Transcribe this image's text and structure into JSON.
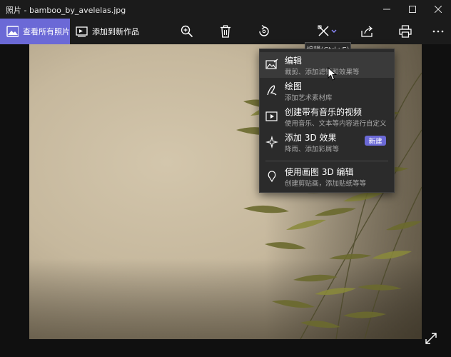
{
  "window": {
    "title": "照片 - bamboo_by_avelelas.jpg",
    "controls": [
      "minimize",
      "maximize",
      "close"
    ]
  },
  "toolbar": {
    "view_all_label": "查看所有照片",
    "add_to_creation_label": "添加到新作品",
    "icons": [
      "zoom-icon",
      "delete-icon",
      "rotate-icon",
      "edit-create-icon",
      "share-icon",
      "print-icon",
      "more-icon"
    ]
  },
  "tooltip": {
    "text": "编辑(Ctrl+E)"
  },
  "menu": {
    "items": [
      {
        "title": "编辑",
        "subtitle": "裁剪、添加滤镜和效果等",
        "icon": "edit-photo-icon",
        "highlighted": true
      },
      {
        "title": "绘图",
        "subtitle": "添加艺术素材库",
        "icon": "draw-icon"
      },
      {
        "title": "创建带有音乐的视频",
        "subtitle": "使用音乐、文本等内容进行自定义",
        "icon": "video-icon"
      },
      {
        "title": "添加 3D 效果",
        "subtitle": "降雨、添加彩屑等",
        "icon": "sparkle-3d-icon",
        "badge": "新建"
      },
      {
        "title": "使用画图 3D 编辑",
        "subtitle": "创建剪贴画，添加贴纸等等",
        "icon": "paint3d-icon"
      }
    ]
  },
  "colors": {
    "accent": "#6b69d6",
    "titlebar": "#1b1b1b",
    "menu_bg": "#2b2b2b",
    "menu_highlight": "#3a3a3a"
  }
}
